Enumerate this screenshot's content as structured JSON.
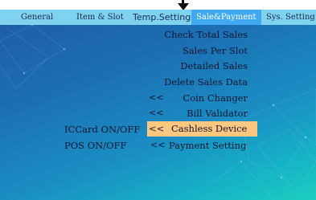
{
  "tabs": [
    {
      "label": "General"
    },
    {
      "label": "Item & Slot"
    },
    {
      "label": "Temp.Setting"
    },
    {
      "label": "Sale&Payment"
    },
    {
      "label": "Sys. Setting"
    }
  ],
  "active_tab": "Sale&Payment",
  "menu": {
    "check_total_sales": "Check Total Sales",
    "sales_per_slot": "Sales Per Slot",
    "detailed_sales": "Detailed Sales",
    "delete_sales_data": "Delete Sales Data",
    "coin_changer": "Coin Changer",
    "bill_validator": "Bill Validator",
    "cashless_device": "Cashless Device",
    "payment_setting": "Payment Setting",
    "arrow": "<<"
  },
  "status": {
    "iccard": "ICCard ON/OFF",
    "pos": "POS ON/OFF"
  },
  "colors": {
    "tabbar": "#7fd2f0",
    "active_tab": "#40a9f2",
    "selection": "#ffc780",
    "background_top": "#1f59a3",
    "background_bottom": "#1ccfbf"
  }
}
